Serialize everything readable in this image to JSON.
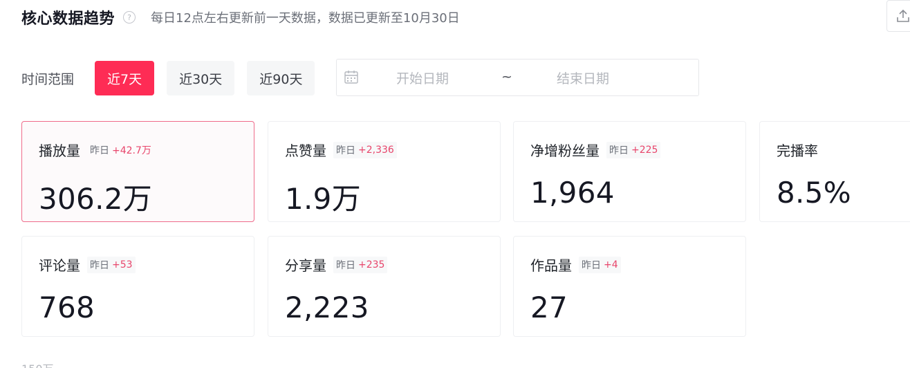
{
  "header": {
    "title": "核心数据趋势",
    "help_glyph": "?",
    "subtitle": "每日12点左右更新前一天数据，数据已更新至10月30日"
  },
  "time_range": {
    "label": "时间范围",
    "options": [
      "近7天",
      "近30天",
      "近90天"
    ],
    "active_index": 0,
    "date_picker": {
      "start_placeholder": "开始日期",
      "separator": "~",
      "end_placeholder": "结束日期"
    }
  },
  "metrics": [
    {
      "label": "播放量",
      "delta_prefix": "昨日",
      "delta": "+42.7万",
      "value": "306.2万",
      "selected": true
    },
    {
      "label": "点赞量",
      "delta_prefix": "昨日",
      "delta": "+2,336",
      "value": "1.9万"
    },
    {
      "label": "净增粉丝量",
      "delta_prefix": "昨日",
      "delta": "+225",
      "value": "1,964"
    },
    {
      "label": "完播率",
      "delta_prefix": "",
      "delta": "",
      "value": "8.5%"
    },
    {
      "label": "评论量",
      "delta_prefix": "昨日",
      "delta": "+53",
      "value": "768"
    },
    {
      "label": "分享量",
      "delta_prefix": "昨日",
      "delta": "+235",
      "value": "2,223"
    },
    {
      "label": "作品量",
      "delta_prefix": "昨日",
      "delta": "+4",
      "value": "27"
    }
  ],
  "chart_axis_label": "150万",
  "colors": {
    "accent": "#fe2c55",
    "delta": "#e8456b",
    "selected_border": "#ef6b8a"
  },
  "icons": {
    "help": "question-circle-icon",
    "calendar": "calendar-icon",
    "export": "upload-icon"
  }
}
